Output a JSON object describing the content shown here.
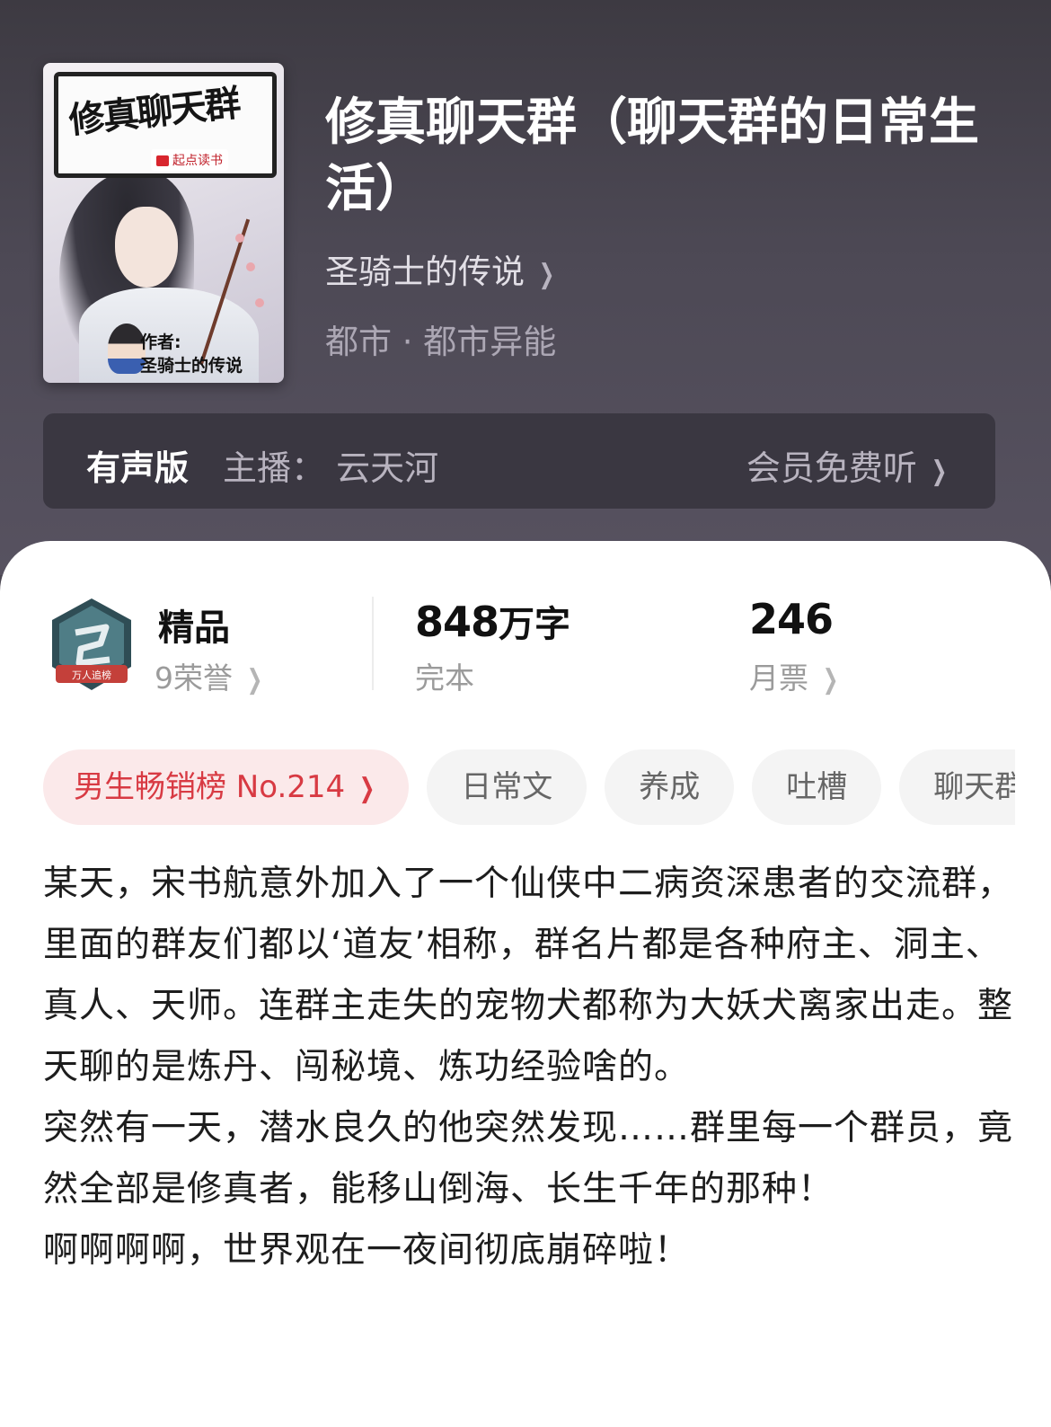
{
  "book": {
    "cover_title": "修真聊天群",
    "cover_publisher": "起点读书",
    "cover_author_line1": "作者:",
    "cover_author_line2": "圣骑士的传说",
    "title": "修真聊天群（聊天群的日常生活）",
    "author": "圣骑士的传说",
    "genre": "都市 · 都市异能"
  },
  "audio": {
    "label": "有声版",
    "host": "主播： 云天河",
    "action": "会员免费听"
  },
  "stats": {
    "honor": {
      "title": "精品",
      "sub": "9荣誉",
      "badge_text": "万人追榜",
      "icon": "honor-badge-icon"
    },
    "words": {
      "value": "848",
      "unit": "万字",
      "sub": "完本"
    },
    "tickets": {
      "value": "246",
      "sub": "月票"
    }
  },
  "tags": [
    "男生畅销榜 No.214",
    "日常文",
    "养成",
    "吐槽",
    "聊天群"
  ],
  "description": [
    "某天，宋书航意外加入了一个仙侠中二病资深患者的交流群，里面的群友们都以‘道友’相称，群名片都是各种府主、洞主、真人、天师。连群主走失的宠物犬都称为大妖犬离家出走。整天聊的是炼丹、闯秘境、炼功经验啥的。",
    "突然有一天，潜水良久的他突然发现……群里每一个群员，竟然全部是修真者，能移山倒海、长生千年的那种！",
    "啊啊啊啊，世界观在一夜间彻底崩碎啦！"
  ],
  "icons": {
    "chevron": "chevron-right-icon"
  },
  "colors": {
    "header_bg": "#4a4651",
    "accent_red": "#d83a43",
    "tag_hot_bg": "#fbe9ea"
  }
}
